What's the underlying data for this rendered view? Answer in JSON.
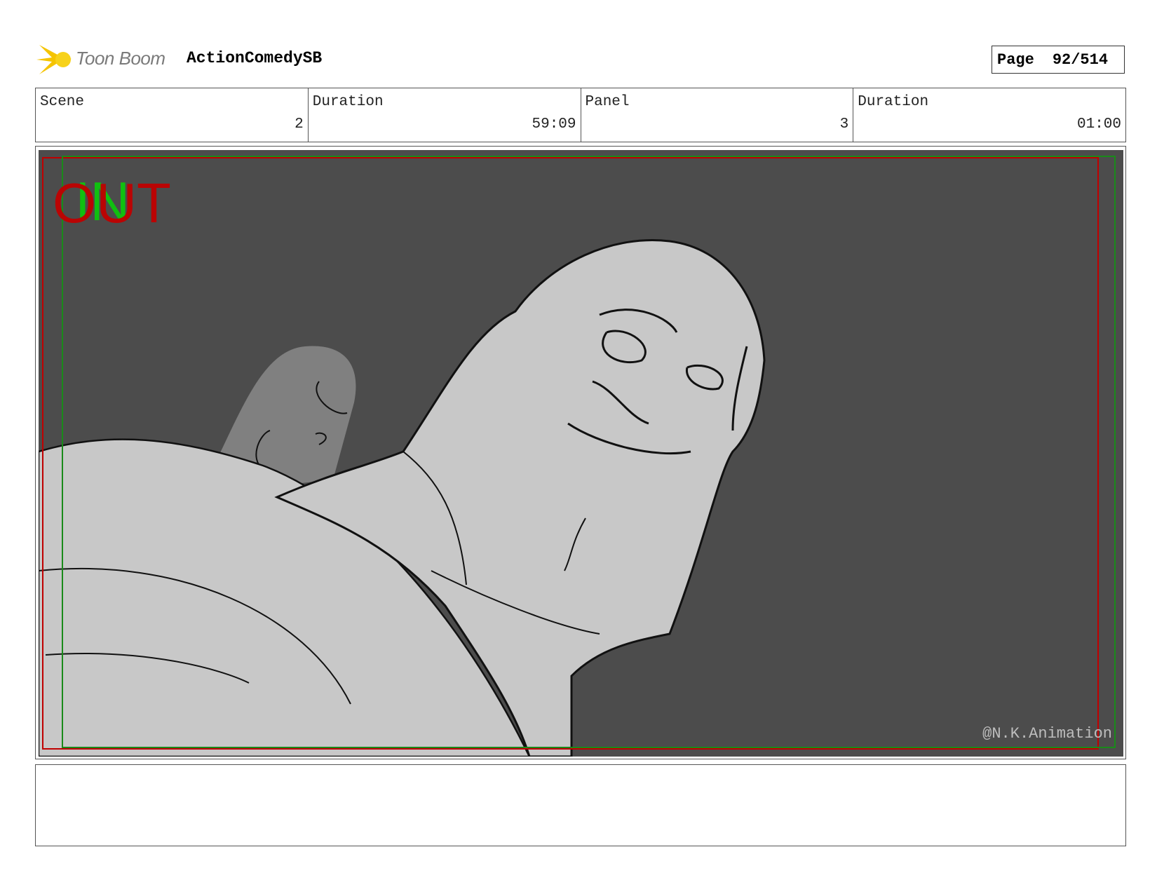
{
  "header": {
    "logo_text": "Toon Boom",
    "project_title": "ActionComedySB",
    "page_label": "Page",
    "page_value": "92/514"
  },
  "info": {
    "scene_label": "Scene",
    "scene_value": "2",
    "scene_duration_label": "Duration",
    "scene_duration_value": "59:09",
    "panel_label": "Panel",
    "panel_value": "3",
    "panel_duration_label": "Duration",
    "panel_duration_value": "01:00"
  },
  "panel": {
    "out_marker": "OUT",
    "in_marker": "IN",
    "watermark": "@N.K.Animation",
    "colors": {
      "background": "#4c4c4c",
      "out_frame": "#c00000",
      "in_frame": "#1a8a1a",
      "in_text": "#10c010",
      "figure": "#c8c8c8",
      "background_figure": "#808080"
    }
  },
  "notes": {}
}
